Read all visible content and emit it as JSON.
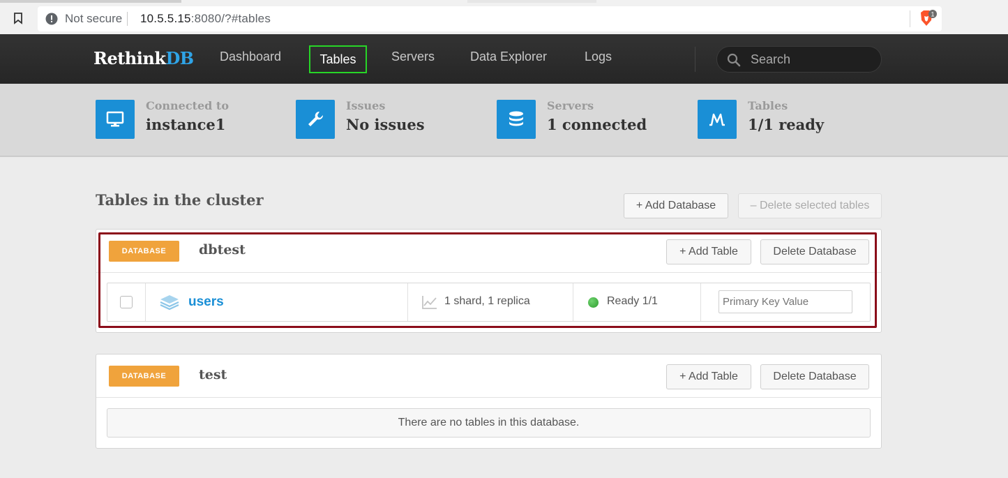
{
  "browser": {
    "security_label": "Not secure",
    "url_host": "10.5.5.15",
    "url_rest": ":8080/?#tables",
    "shield_badge": "1"
  },
  "navbar": {
    "logo_main": "Rethink",
    "logo_accent": "DB",
    "links": [
      "Dashboard",
      "Tables",
      "Servers",
      "Data Explorer",
      "Logs"
    ],
    "active": "Tables",
    "search_placeholder": "Search"
  },
  "stats": [
    {
      "label": "Connected to",
      "value": "instance1",
      "icon": "monitor-icon"
    },
    {
      "label": "Issues",
      "value": "No issues",
      "icon": "wrench-icon"
    },
    {
      "label": "Servers",
      "value": "1 connected",
      "icon": "database-icon"
    },
    {
      "label": "Tables",
      "value": "1/1 ready",
      "icon": "table-chart-icon"
    }
  ],
  "main": {
    "title": "Tables in the cluster",
    "add_database": "+ Add Database",
    "delete_selected": "– Delete selected tables"
  },
  "databases": [
    {
      "badge": "DATABASE",
      "name": "dbtest",
      "add_table": "+ Add Table",
      "delete_database": "Delete Database",
      "tables": [
        {
          "name": "users",
          "shards": "1 shard, 1 replica",
          "status": "Ready 1/1",
          "pk_placeholder": "Primary Key Value"
        }
      ]
    },
    {
      "badge": "DATABASE",
      "name": "test",
      "add_table": "+ Add Table",
      "delete_database": "Delete Database",
      "empty_message": "There are no tables in this database."
    }
  ],
  "colors": {
    "accent_blue": "#1a8fd6",
    "badge_orange": "#f0a33c",
    "active_highlight": "#27d627",
    "selection_outline": "#8b0d1a",
    "status_green": "#2f9e2f"
  }
}
